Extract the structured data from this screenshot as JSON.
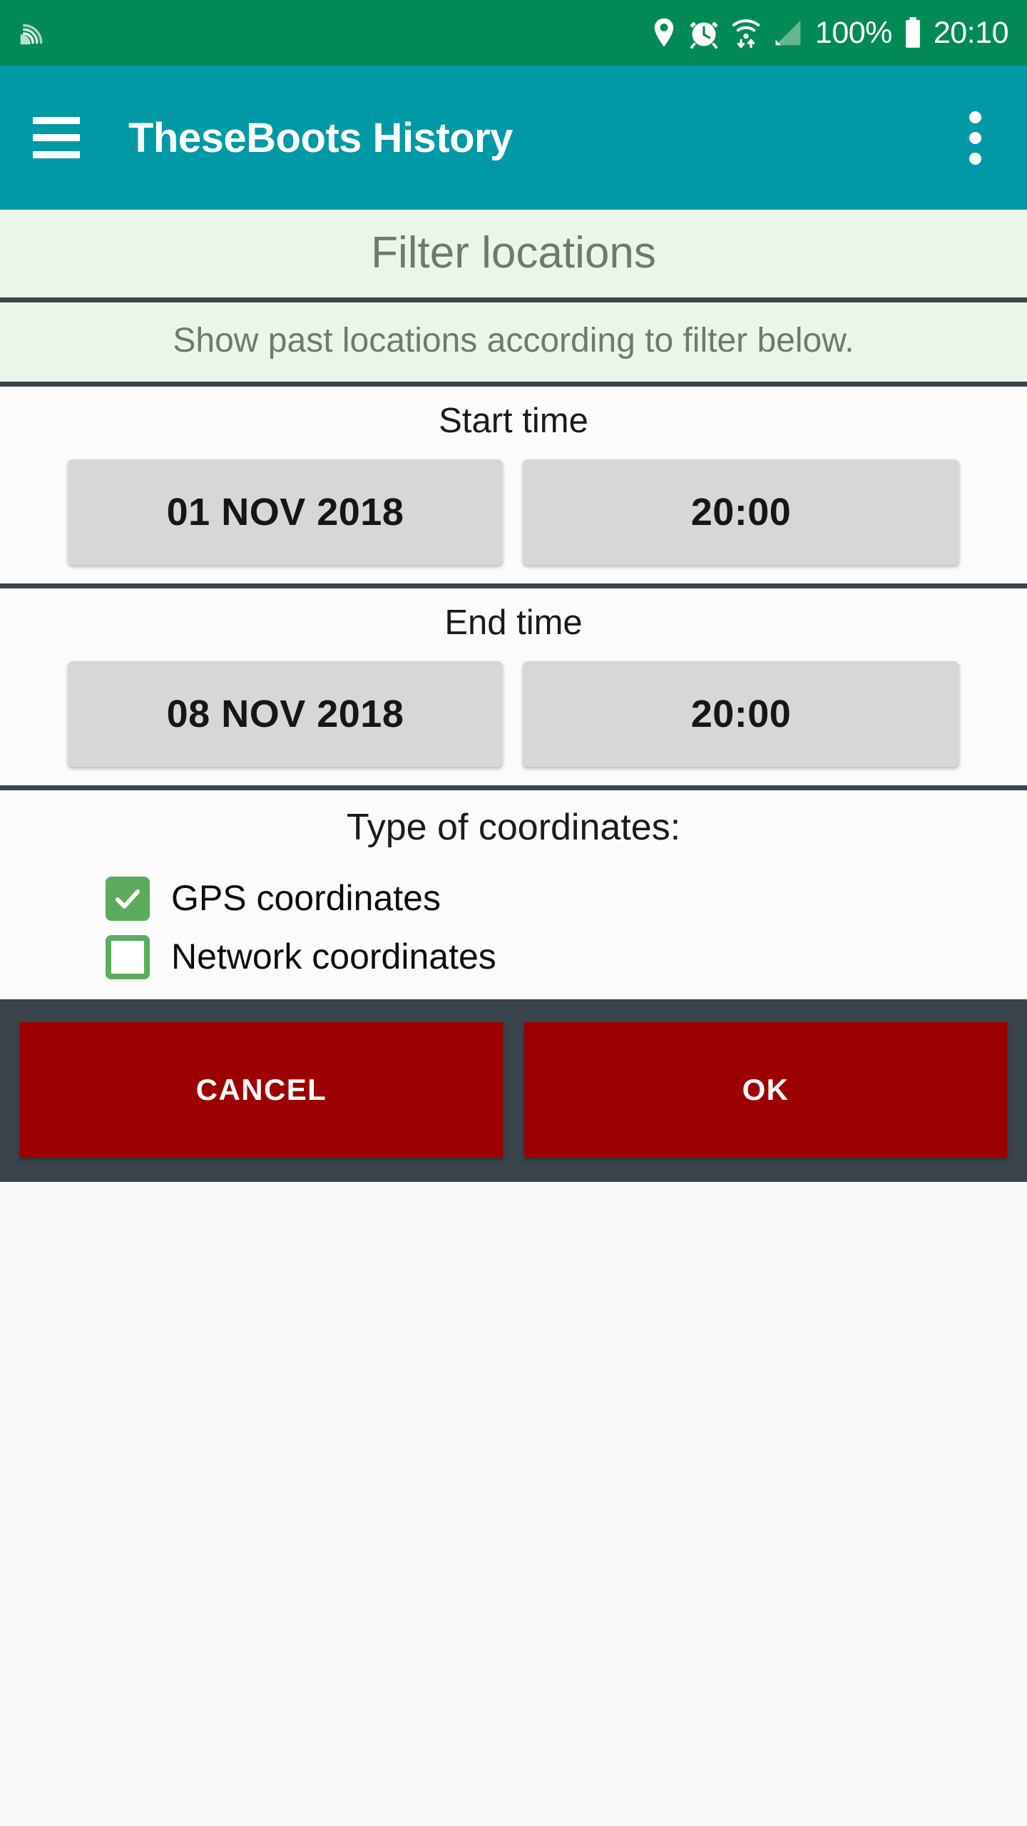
{
  "status_bar": {
    "background": "#018a55",
    "left_icons": [
      "satellite-signal-icon"
    ],
    "right_icons": [
      "location-pin-icon",
      "alarm-clock-icon",
      "wifi-icon",
      "cell-signal-icon",
      "battery-icon"
    ],
    "battery_percent": "100%",
    "clock": "20:10"
  },
  "app_bar": {
    "background": "#009aa6",
    "menu_icon": "hamburger-menu-icon",
    "title": "TheseBoots History",
    "overflow_icon": "overflow-menu-icon"
  },
  "dialog": {
    "title": "Filter locations",
    "subtitle": "Show past locations according to filter below.",
    "header_background": "#e8f7e8",
    "divider_color": "#39444c",
    "start": {
      "label": "Start time",
      "date": "01 NOV 2018",
      "time": "20:00"
    },
    "end": {
      "label": "End time",
      "date": "08 NOV 2018",
      "time": "20:00"
    },
    "coordinates": {
      "title": "Type of coordinates:",
      "accent": "#5cab5c",
      "options": [
        {
          "label": "GPS coordinates",
          "checked": true
        },
        {
          "label": "Network coordinates",
          "checked": false
        }
      ]
    },
    "actions": {
      "bar_background": "#39444c",
      "button_color": "#9d0000",
      "cancel": "CANCEL",
      "ok": "OK"
    }
  }
}
